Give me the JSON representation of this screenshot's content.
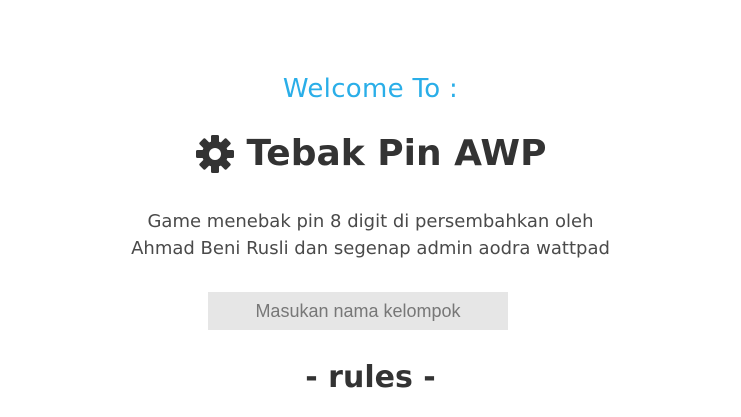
{
  "welcome": {
    "heading": "Welcome To :",
    "color": "#2aaee8"
  },
  "game": {
    "icon": "gear-icon",
    "title": "Tebak Pin AWP"
  },
  "description": {
    "line1": "Game menebak pin 8 digit di persembahkan oleh",
    "line2": "Ahmad Beni Rusli dan segenap admin aodra wattpad"
  },
  "group_input": {
    "placeholder": "Masukan nama kelompok",
    "value": ""
  },
  "rules": {
    "heading": "- rules -"
  }
}
